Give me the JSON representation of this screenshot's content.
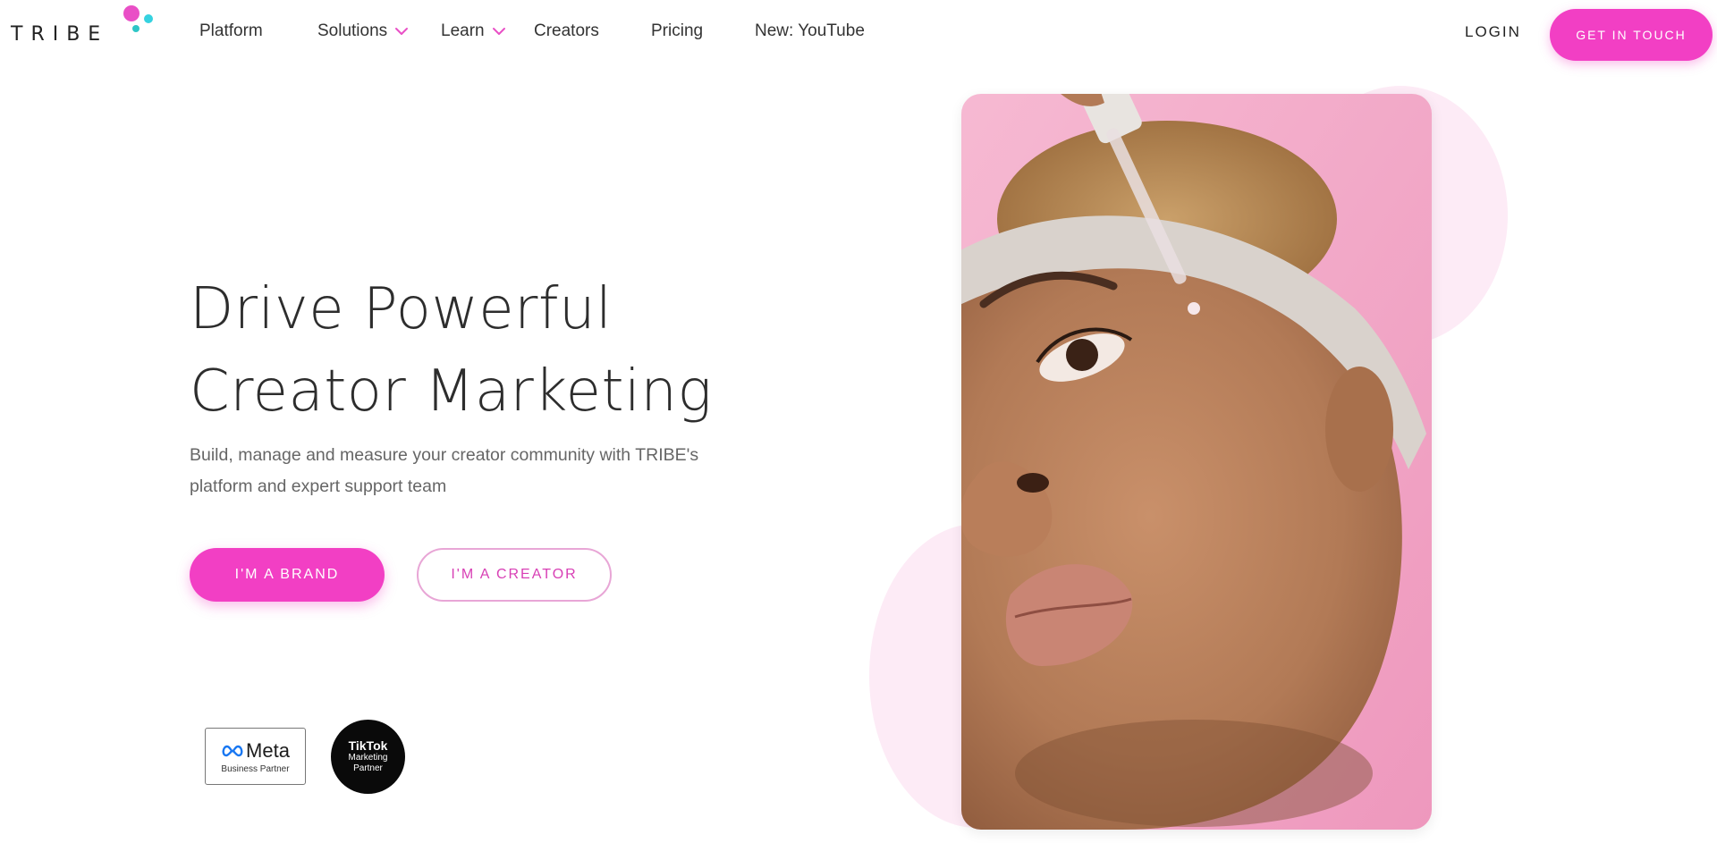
{
  "brand": {
    "logo_text": "TRIBE",
    "accent": "#f23fc4"
  },
  "nav": {
    "items": [
      {
        "label": "Platform",
        "has_dropdown": false
      },
      {
        "label": "Solutions",
        "has_dropdown": true
      },
      {
        "label": "Learn",
        "has_dropdown": true
      },
      {
        "label": "Creators",
        "has_dropdown": false
      },
      {
        "label": "Pricing",
        "has_dropdown": false
      },
      {
        "label": "New: YouTube",
        "has_dropdown": false
      }
    ],
    "login_label": "LOGIN",
    "cta_label": "GET IN TOUCH"
  },
  "hero": {
    "title_line1": "Drive Powerful",
    "title_line2": "Creator Marketing",
    "subtitle_line1": "Build, manage and measure your creator community with TRIBE's",
    "subtitle_line2": "platform and expert support team",
    "brand_button": "I'M A BRAND",
    "creator_button": "I'M A CREATOR"
  },
  "partners": {
    "meta": {
      "name": "Meta",
      "subtitle": "Business Partner"
    },
    "tiktok": {
      "name": "TikTok",
      "line2": "Marketing",
      "line3": "Partner"
    }
  },
  "icons": {
    "dropdown": "chevron-down-icon",
    "meta_logo": "meta-infinity-icon"
  },
  "colors": {
    "pink": "#f23fc4",
    "chevron": "#e94fc6",
    "cyan": "#35d2e0",
    "photo_bg": "#f2a5c5"
  }
}
